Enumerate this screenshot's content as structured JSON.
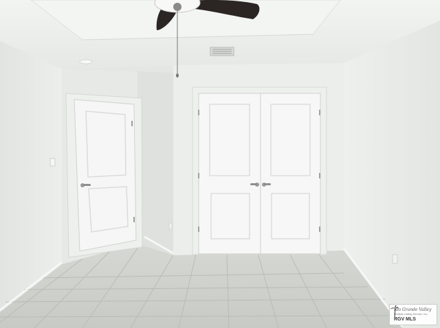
{
  "scene": {
    "description_colors": {
      "wall": "#e9ebe9",
      "wall_shadow": "#dcdedc",
      "ceiling": "#eef0ee",
      "door": "#f4f5f4",
      "door_frame": "#eceeec",
      "floor_tile": "#cfd1cc",
      "grout": "#b9bbb6",
      "fan_blade": "#2b2623"
    },
    "objects": [
      "ceiling-fan",
      "hvac-vent",
      "recessed-light",
      "entry-door",
      "closet-double-door",
      "light-switch",
      "wall-outlet",
      "tile-floor"
    ]
  },
  "watermark": {
    "script_text": "Rio Grande Valley",
    "sub_text": "Multiple Listing Service, Inc.",
    "label": "RGV MLS",
    "icon": "palm-tree-icon"
  }
}
